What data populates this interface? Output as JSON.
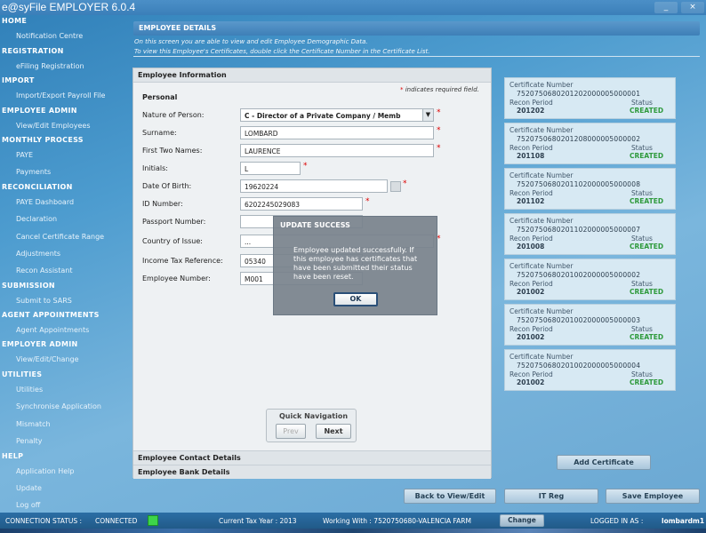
{
  "app": {
    "title": "e@syFile EMPLOYER 6.0.4",
    "min": "_",
    "close": "×"
  },
  "sidebar": {
    "home_header": "HOME",
    "notification": "Notification Centre",
    "registration_header": "REGISTRATION",
    "efiling": "eFiling Registration",
    "import_header": "IMPORT",
    "import_payroll": "Import/Export Payroll File",
    "employee_admin_header": "EMPLOYEE ADMIN",
    "view_edit_employees": "View/Edit Employees",
    "monthly_header": "MONTHLY PROCESS",
    "paye": "PAYE",
    "payments": "Payments",
    "reconciliation_header": "RECONCILIATION",
    "paye_dashboard": "PAYE Dashboard",
    "declaration": "Declaration",
    "cancel_cert": "Cancel Certificate Range",
    "adjustments": "Adjustments",
    "recon_assistant": "Recon Assistant",
    "submission_header": "SUBMISSION",
    "submit_sars": "Submit to SARS",
    "agent_header": "AGENT APPOINTMENTS",
    "agent_appointments": "Agent Appointments",
    "employer_admin_header": "EMPLOYER ADMIN",
    "view_edit_change": "View/Edit/Change",
    "utilities_header": "UTILITIES",
    "utilities": "Utilities",
    "synchronise": "Synchronise Application",
    "mismatch": "Mismatch",
    "penalty": "Penalty",
    "help_header": "HELP",
    "app_help": "Application Help",
    "update": "Update",
    "logoff": "Log off"
  },
  "details": {
    "title": "EMPLOYEE DETAILS",
    "info1": "On this screen you are able to view and edit Employee Demographic Data.",
    "info2": "To view this Employee's Certificates, double click the Certificate Number in the Certificate List."
  },
  "form": {
    "section_title": "Employee Information",
    "personal": "Personal",
    "required_note": "indicates required field.",
    "labels": {
      "nature": "Nature of Person:",
      "surname": "Surname:",
      "first_names": "First Two Names:",
      "initials": "Initials:",
      "dob": "Date Of Birth:",
      "id": "ID Number:",
      "passport": "Passport Number:",
      "country": "Country of Issue:",
      "tax_ref": "Income Tax Reference:",
      "emp_no": "Employee Number:"
    },
    "values": {
      "nature": "C - Director of a Private Company / Memb",
      "surname": "LOMBARD",
      "first_names": "LAURENCE",
      "initials": "L",
      "dob": "19620224",
      "id": "6202245029083",
      "passport": "",
      "country": "...",
      "tax_ref": "05340",
      "emp_no": "M001"
    },
    "quick_nav": {
      "title": "Quick Navigation",
      "prev": "Prev",
      "next": "Next"
    },
    "contact_details": "Employee Contact Details",
    "bank_details": "Employee Bank Details"
  },
  "certificates": {
    "label_number": "Certificate Number",
    "label_period": "Recon Period",
    "label_status": "Status",
    "items": [
      {
        "number": "7520750680201202000005000001",
        "period": "201202",
        "status": "CREATED"
      },
      {
        "number": "7520750680201208000005000002",
        "period": "201108",
        "status": "CREATED"
      },
      {
        "number": "7520750680201102000005000008",
        "period": "201102",
        "status": "CREATED"
      },
      {
        "number": "7520750680201102000005000007",
        "period": "201008",
        "status": "CREATED"
      },
      {
        "number": "7520750680201002000005000002",
        "period": "201002",
        "status": "CREATED"
      },
      {
        "number": "7520750680201002000005000003",
        "period": "201002",
        "status": "CREATED"
      },
      {
        "number": "7520750680201002000005000004",
        "period": "201002",
        "status": "CREATED"
      }
    ],
    "add_button": "Add Certificate"
  },
  "actions": {
    "back": "Back to View/Edit",
    "itreg": "IT Reg",
    "save": "Save Employee"
  },
  "dialog": {
    "title": "UPDATE SUCCESS",
    "message": "Employee updated successfully. If this employee has certificates that have been submitted their status have been reset.",
    "ok": "OK"
  },
  "status": {
    "label": "CONNECTION STATUS :",
    "value": "CONNECTED",
    "tax_year": "Current Tax Year : 2013",
    "working": "Working With : 7520750680-VALENCIA FARM",
    "change": "Change",
    "logged_label": "LOGGED IN AS :",
    "logged_user": "lombardm1"
  },
  "colors": {
    "accent": "#3e7fb7",
    "status_created": "#2e9a3c",
    "required": "#dd0000",
    "connected": "#3dd44a"
  }
}
